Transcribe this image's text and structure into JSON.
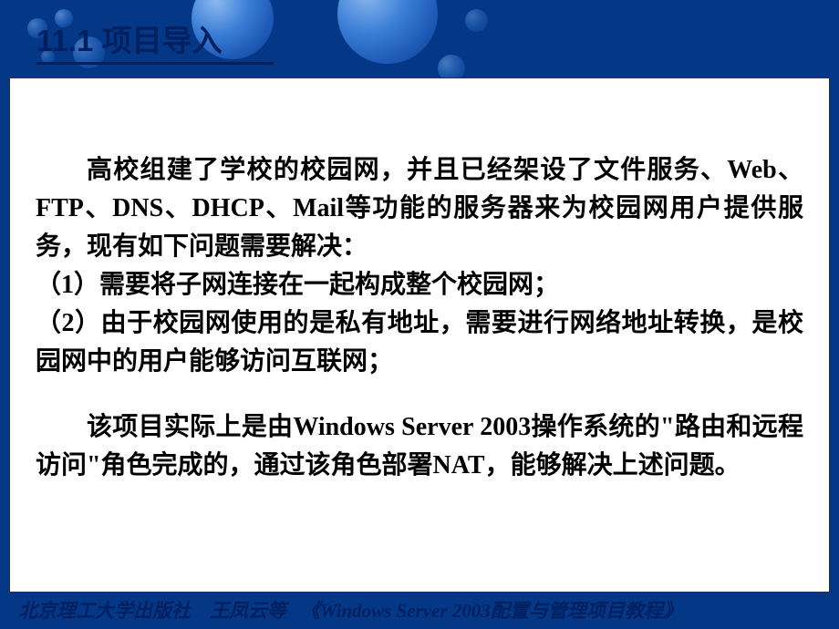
{
  "header": {
    "section_number": "11.1",
    "section_title": "项目导入"
  },
  "body": {
    "paragraph1_intro": "高校组建了学校的校园网，并且已经架设了文件服务、Web、FTP、DNS、DHCP、Mail等功能的服务器来为校园网用户提供服务，现有如下问题需要解决：",
    "item1": "（1）需要将子网连接在一起构成整个校园网；",
    "item2": "（2）由于校园网使用的是私有地址，需要进行网络地址转换，是校园网中的用户能够访问互联网；",
    "paragraph2": "该项目实际上是由Windows Server 2003操作系统的\"路由和远程访问\"角色完成的，通过该角色部署NAT，能够解决上述问题。"
  },
  "footer": {
    "publisher": "北京理工大学出版社",
    "author": "王凤云等",
    "book_title": "《Windows Server 2003配置与管理项目教程》"
  }
}
